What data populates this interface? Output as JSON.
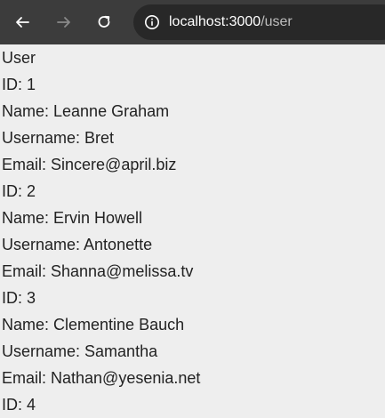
{
  "browser": {
    "url_host": "localhost:3000",
    "url_path": "/user",
    "icons": {
      "back": "arrow-left-icon",
      "forward": "arrow-right-icon",
      "reload": "reload-icon",
      "site_info": "info-icon"
    }
  },
  "page": {
    "heading": "User",
    "users": [
      {
        "id": "ID: 1",
        "name": "Name: Leanne Graham",
        "username": "Username: Bret",
        "email": "Email: Sincere@april.biz"
      },
      {
        "id": "ID: 2",
        "name": "Name: Ervin Howell",
        "username": "Username: Antonette",
        "email": "Email: Shanna@melissa.tv"
      },
      {
        "id": "ID: 3",
        "name": "Name: Clementine Bauch",
        "username": "Username: Samantha",
        "email": "Email: Nathan@yesenia.net"
      },
      {
        "id": "ID: 4"
      }
    ]
  }
}
